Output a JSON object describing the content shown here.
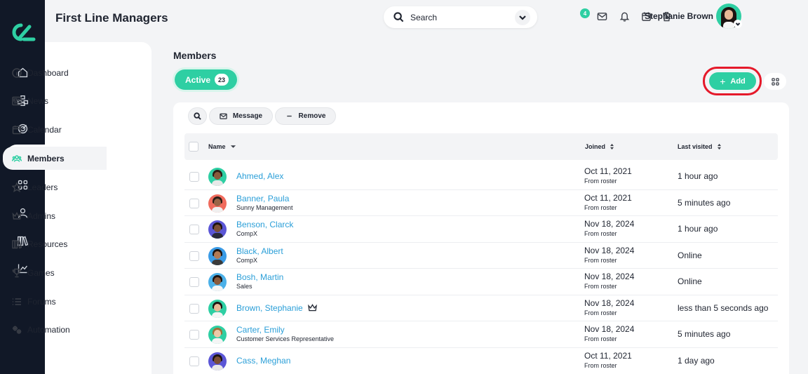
{
  "header": {
    "title": "First Line Managers",
    "search_placeholder": "Search",
    "notification_count": "4",
    "user_name": "Stephanie Brown"
  },
  "rail": {
    "items": [
      "home-icon",
      "org-icon",
      "target-icon",
      "members-icon",
      "grid-icon",
      "user-icon",
      "library-icon",
      "chart-icon"
    ],
    "active": "members-icon"
  },
  "sidebar": {
    "items": [
      {
        "label": "Dashboard",
        "icon": "info-icon"
      },
      {
        "label": "News",
        "icon": "news-icon"
      },
      {
        "label": "Calendar",
        "icon": "calendar-icon"
      },
      {
        "label": "Members",
        "icon": "members-icon"
      },
      {
        "label": "Leaders",
        "icon": "star-icon"
      },
      {
        "label": "Admins",
        "icon": "crown-icon"
      },
      {
        "label": "Resources",
        "icon": "books-icon"
      },
      {
        "label": "Games",
        "icon": "trophy-icon"
      },
      {
        "label": "Forums",
        "icon": "list-icon"
      },
      {
        "label": "Automation",
        "icon": "cogs-icon"
      }
    ],
    "active": "Members"
  },
  "main": {
    "title": "Members",
    "status_tab": {
      "label": "Active",
      "count": "23"
    },
    "add_label": "Add",
    "toolbar": {
      "message_label": "Message",
      "remove_label": "Remove"
    },
    "columns": {
      "name": "Name",
      "joined": "Joined",
      "last_visited": "Last visited"
    },
    "rows": [
      {
        "name": "Ahmed, Alex",
        "subtitle": "",
        "joined": "Oct 11, 2021",
        "source": "From roster",
        "last_visited": "1 hour ago",
        "admin": false
      },
      {
        "name": "Banner, Paula",
        "subtitle": "Sunny Management",
        "joined": "Oct 11, 2021",
        "source": "From roster",
        "last_visited": "5 minutes ago",
        "admin": false
      },
      {
        "name": "Benson, Clarck",
        "subtitle": "CompX",
        "joined": "Nov 18, 2024",
        "source": "From roster",
        "last_visited": "1 hour ago",
        "admin": false
      },
      {
        "name": "Black, Albert",
        "subtitle": "CompX",
        "joined": "Nov 18, 2024",
        "source": "From roster",
        "last_visited": "Online",
        "admin": false
      },
      {
        "name": "Bosh, Martin",
        "subtitle": "Sales",
        "joined": "Nov 18, 2024",
        "source": "From roster",
        "last_visited": "Online",
        "admin": false
      },
      {
        "name": "Brown, Stephanie",
        "subtitle": "",
        "joined": "Nov 18, 2024",
        "source": "From roster",
        "last_visited": "less than 5 seconds ago",
        "admin": true
      },
      {
        "name": "Carter, Emily",
        "subtitle": "Customer Services Representative",
        "joined": "Nov 18, 2024",
        "source": "From roster",
        "last_visited": "5 minutes ago",
        "admin": false
      },
      {
        "name": "Cass, Meghan",
        "subtitle": "",
        "joined": "Oct 11, 2021",
        "source": "From roster",
        "last_visited": "1 day ago",
        "admin": false
      }
    ]
  },
  "colors": {
    "accent": "#2ecfa3",
    "rail_bg": "#111827",
    "link": "#2b9fd8",
    "highlight_ring": "#e5192a"
  }
}
